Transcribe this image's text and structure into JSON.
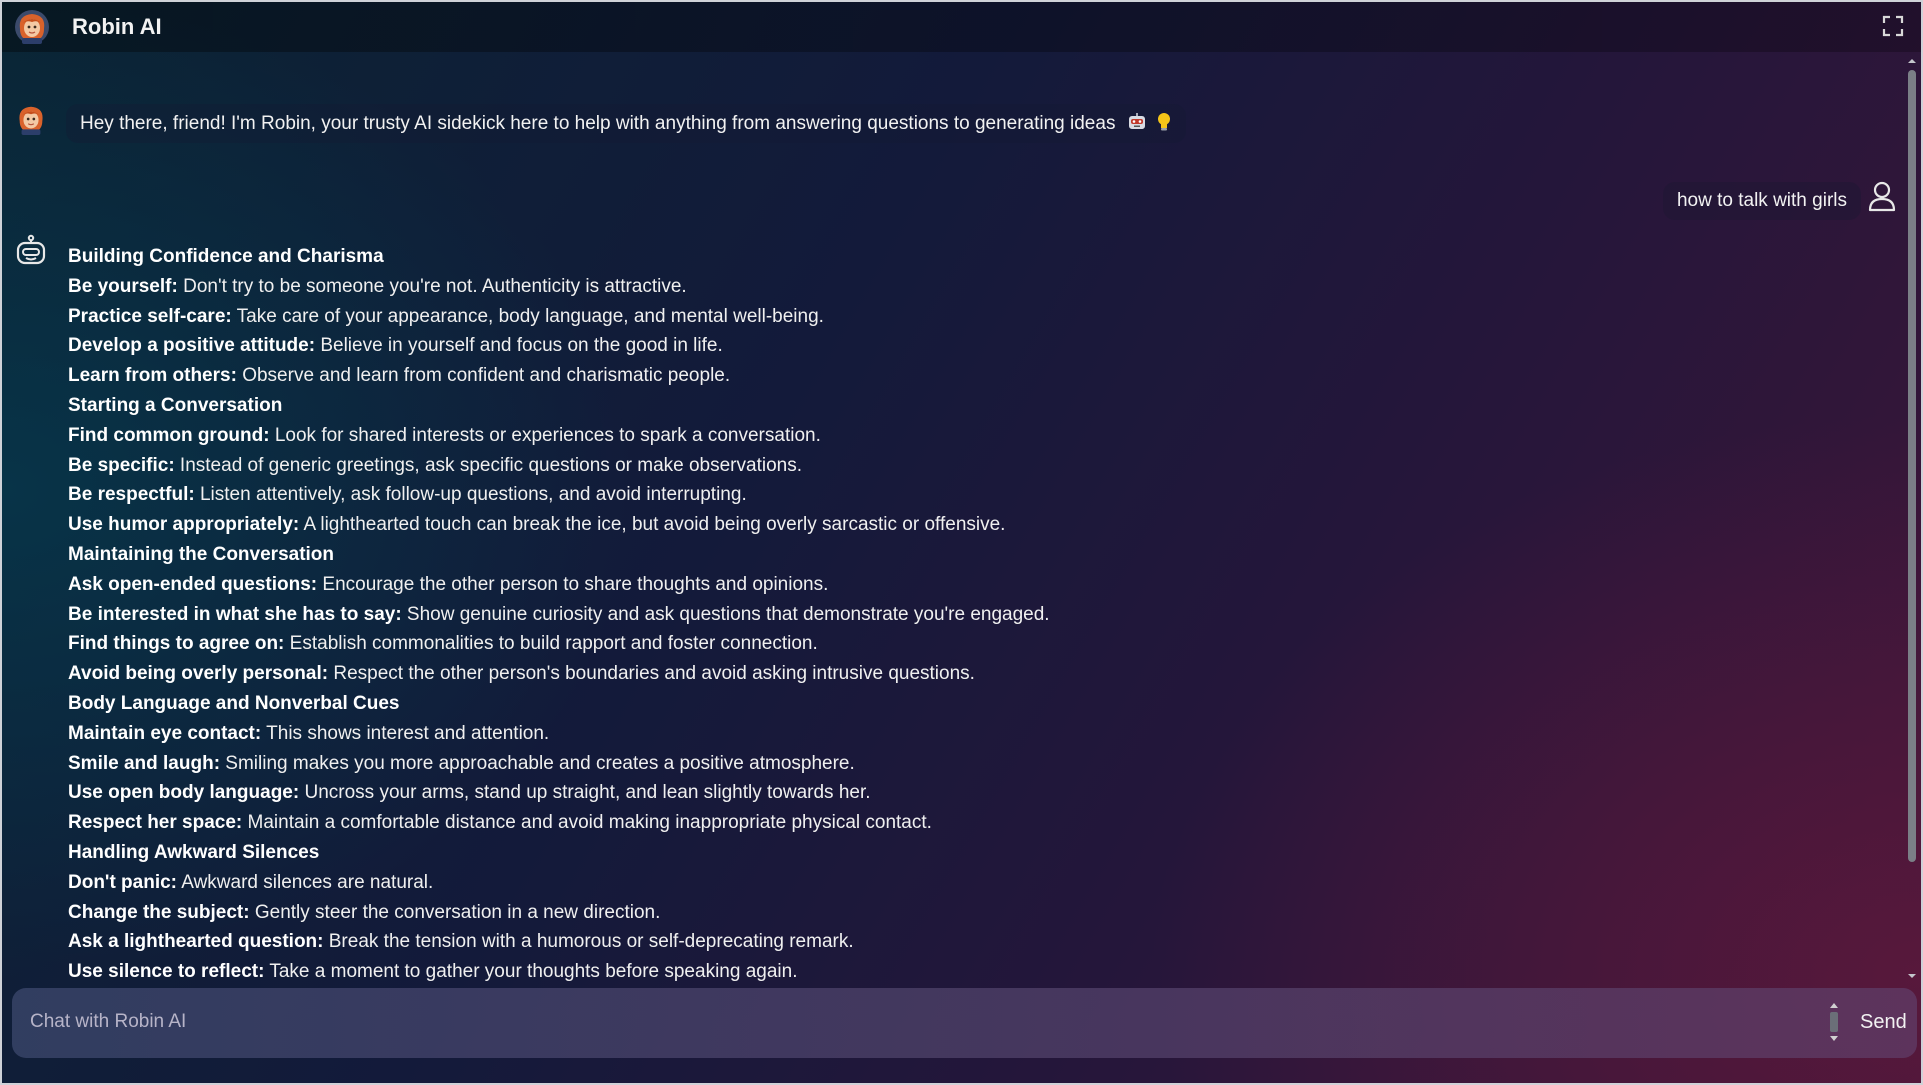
{
  "app": {
    "title": "Robin AI"
  },
  "icons": {
    "avatar": "robin-avatar-icon",
    "fullscreen": "fullscreen-icon",
    "user": "user-icon",
    "bot": "robot-icon",
    "emoji_1": "robot-face-emoji-icon",
    "emoji_2": "lightbulb-emoji-icon"
  },
  "colors": {
    "bg_start": "#0a2434",
    "bg_end": "#3e1638",
    "text": "#f0f0f0"
  },
  "intro_message": {
    "text": "Hey there, friend! I'm Robin, your trusty AI sidekick here to help with anything from answering questions to generating ideas"
  },
  "user_message": {
    "text": "how to talk with girls"
  },
  "response": {
    "lines": [
      {
        "type": "heading",
        "text": "Building Confidence and Charisma"
      },
      {
        "type": "item",
        "term": "Be yourself:",
        "desc": " Don't try to be someone you're not. Authenticity is attractive."
      },
      {
        "type": "item",
        "term": "Practice self-care:",
        "desc": " Take care of your appearance, body language, and mental well-being."
      },
      {
        "type": "item",
        "term": "Develop a positive attitude:",
        "desc": " Believe in yourself and focus on the good in life."
      },
      {
        "type": "item",
        "term": "Learn from others:",
        "desc": " Observe and learn from confident and charismatic people."
      },
      {
        "type": "heading",
        "text": "Starting a Conversation"
      },
      {
        "type": "item",
        "term": "Find common ground:",
        "desc": " Look for shared interests or experiences to spark a conversation."
      },
      {
        "type": "item",
        "term": "Be specific:",
        "desc": " Instead of generic greetings, ask specific questions or make observations."
      },
      {
        "type": "item",
        "term": "Be respectful:",
        "desc": " Listen attentively, ask follow-up questions, and avoid interrupting."
      },
      {
        "type": "item",
        "term": "Use humor appropriately:",
        "desc": " A lighthearted touch can break the ice, but avoid being overly sarcastic or offensive."
      },
      {
        "type": "heading",
        "text": "Maintaining the Conversation"
      },
      {
        "type": "item",
        "term": "Ask open-ended questions:",
        "desc": " Encourage the other person to share thoughts and opinions."
      },
      {
        "type": "item",
        "term": "Be interested in what she has to say:",
        "desc": " Show genuine curiosity and ask questions that demonstrate you're engaged."
      },
      {
        "type": "item",
        "term": "Find things to agree on:",
        "desc": " Establish commonalities to build rapport and foster connection."
      },
      {
        "type": "item",
        "term": "Avoid being overly personal:",
        "desc": " Respect the other person's boundaries and avoid asking intrusive questions."
      },
      {
        "type": "heading",
        "text": "Body Language and Nonverbal Cues"
      },
      {
        "type": "item",
        "term": "Maintain eye contact:",
        "desc": " This shows interest and attention."
      },
      {
        "type": "item",
        "term": "Smile and laugh:",
        "desc": " Smiling makes you more approachable and creates a positive atmosphere."
      },
      {
        "type": "item",
        "term": "Use open body language:",
        "desc": " Uncross your arms, stand up straight, and lean slightly towards her."
      },
      {
        "type": "item",
        "term": "Respect her space:",
        "desc": " Maintain a comfortable distance and avoid making inappropriate physical contact."
      },
      {
        "type": "heading",
        "text": "Handling Awkward Silences"
      },
      {
        "type": "item",
        "term": "Don't panic:",
        "desc": " Awkward silences are natural."
      },
      {
        "type": "item",
        "term": "Change the subject:",
        "desc": " Gently steer the conversation in a new direction."
      },
      {
        "type": "item",
        "term": "Ask a lighthearted question:",
        "desc": " Break the tension with a humorous or self-deprecating remark."
      },
      {
        "type": "item",
        "term": "Use silence to reflect:",
        "desc": " Take a moment to gather your thoughts before speaking again."
      }
    ]
  },
  "input": {
    "placeholder": "Chat with Robin AI",
    "value": "",
    "send_label": "Send"
  }
}
